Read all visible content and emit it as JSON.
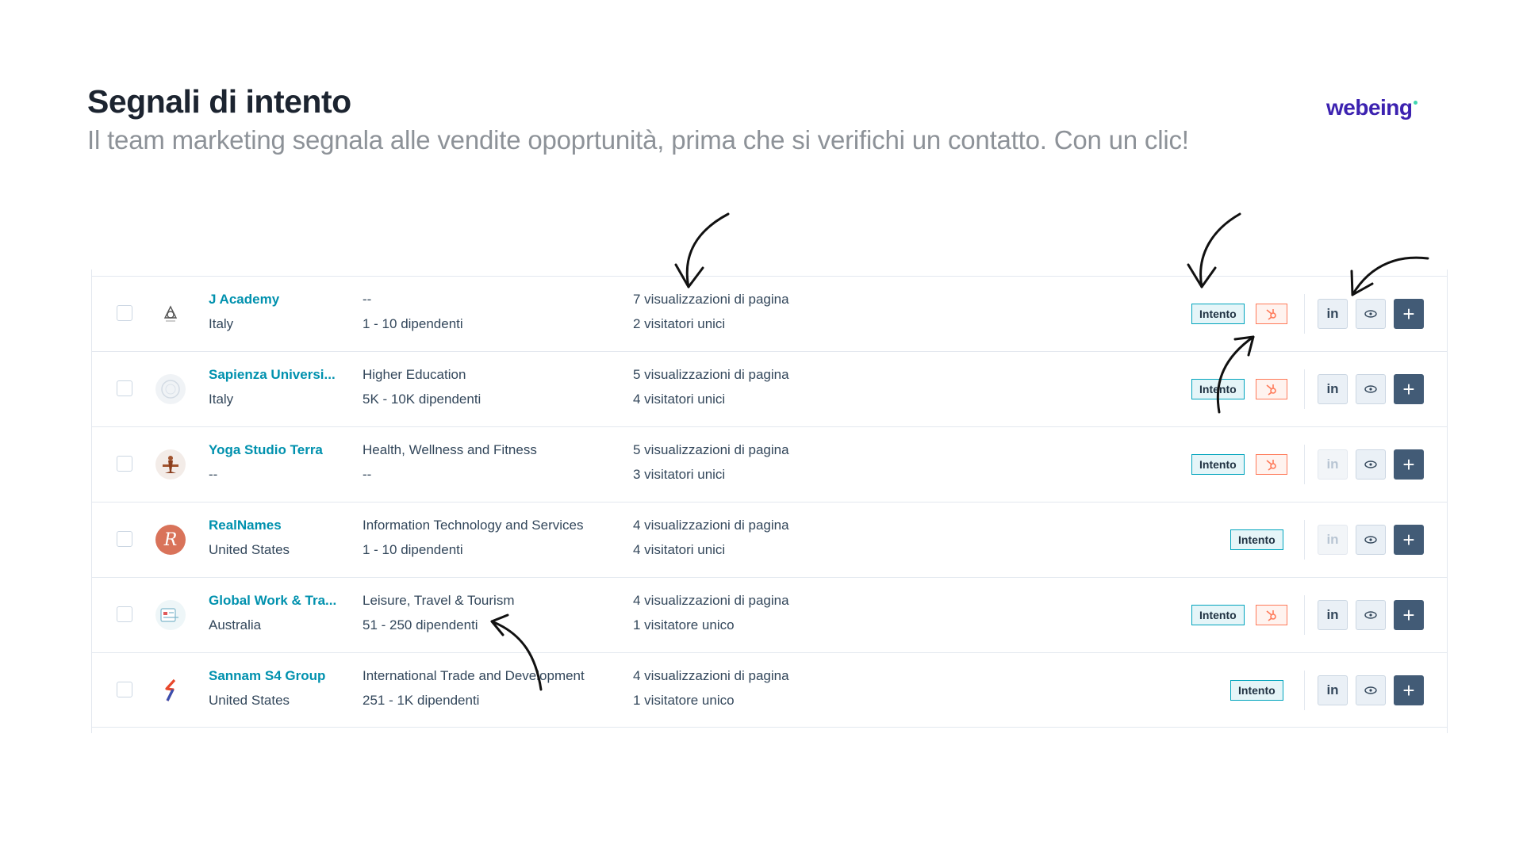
{
  "slide": {
    "title": "Segnali di intento",
    "subtitle": "Il team marketing segnala alle vendite opoprtunità, prima che si verifichi un contatto. Con un clic!",
    "logo_text": "webeing"
  },
  "table": {
    "intent_label": "Intento",
    "linkedin_label": "in",
    "add_label": "+",
    "rows": [
      {
        "name": "J Academy",
        "location": "Italy",
        "industry": "--",
        "size": "1 - 10 dipendenti",
        "views": "7 visualizzazioni di pagina",
        "visitors": "2 visitatori unici",
        "hubspot_tag": true,
        "linkedin_enabled": true,
        "logo_icon": "triquetra-logo"
      },
      {
        "name": "Sapienza Universi...",
        "location": "Italy",
        "industry": "Higher Education",
        "size": "5K - 10K dipendenti",
        "views": "5 visualizzazioni di pagina",
        "visitors": "4 visitatori unici",
        "hubspot_tag": true,
        "linkedin_enabled": true,
        "logo_icon": "university-seal-logo"
      },
      {
        "name": "Yoga Studio Terra",
        "location": "--",
        "industry": "Health, Wellness and Fitness",
        "size": "--",
        "views": "5 visualizzazioni di pagina",
        "visitors": "3 visitatori unici",
        "hubspot_tag": true,
        "linkedin_enabled": false,
        "logo_icon": "yoga-figure-logo"
      },
      {
        "name": "RealNames",
        "location": "United States",
        "industry": "Information Technology and Services",
        "size": "1 - 10 dipendenti",
        "views": "4 visualizzazioni di pagina",
        "visitors": "4 visitatori unici",
        "hubspot_tag": false,
        "linkedin_enabled": false,
        "logo_icon": "r-circle-logo"
      },
      {
        "name": "Global Work & Tra...",
        "location": "Australia",
        "industry": "Leisure, Travel & Tourism",
        "size": "51 - 250 dipendenti",
        "views": "4 visualizzazioni di pagina",
        "visitors": "1 visitatore unico",
        "hubspot_tag": true,
        "linkedin_enabled": true,
        "logo_icon": "card-logo"
      },
      {
        "name": "Sannam S4 Group",
        "location": "United States",
        "industry": "International Trade and Development",
        "size": "251 - 1K dipendenti",
        "views": "4 visualizzazioni di pagina",
        "visitors": "1 visitatore unico",
        "hubspot_tag": false,
        "linkedin_enabled": true,
        "logo_icon": "s-swoosh-logo"
      }
    ]
  },
  "colors": {
    "company_link": "#0091ae",
    "intent_border": "#00a4bd",
    "hubspot_orange": "#ff7a59",
    "add_button": "#425b76",
    "logo_purple": "#3c22b0"
  }
}
